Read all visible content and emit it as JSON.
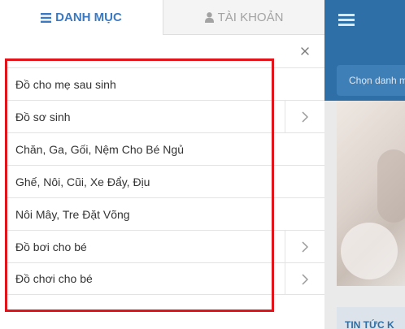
{
  "tabs": [
    {
      "label": "DANH MỤC",
      "icon": "list-icon",
      "active": true
    },
    {
      "label": "TÀI KHOẢN",
      "icon": "user-icon",
      "active": false
    }
  ],
  "close_label": "×",
  "menu": [
    {
      "label": "Đồ cho mẹ sau sinh",
      "has_submenu": false
    },
    {
      "label": "Đồ sơ sinh",
      "has_submenu": true
    },
    {
      "label": "Chăn, Ga, Gối, Nệm Cho Bé Ngủ",
      "has_submenu": false
    },
    {
      "label": "Ghế, Nôi, Cũi, Xe Đẩy, Địu",
      "has_submenu": false
    },
    {
      "label": "Nôi Mây, Tre Đặt Võng",
      "has_submenu": false
    },
    {
      "label": "Đồ bơi cho bé",
      "has_submenu": true
    },
    {
      "label": "Đồ chơi cho bé",
      "has_submenu": true
    }
  ],
  "background": {
    "select_placeholder": "Chọn danh m",
    "news_heading": "TIN TỨC K"
  },
  "colors": {
    "accent": "#3b79c2",
    "header_bg": "#2f6fa7",
    "highlight": "#e0141a"
  }
}
